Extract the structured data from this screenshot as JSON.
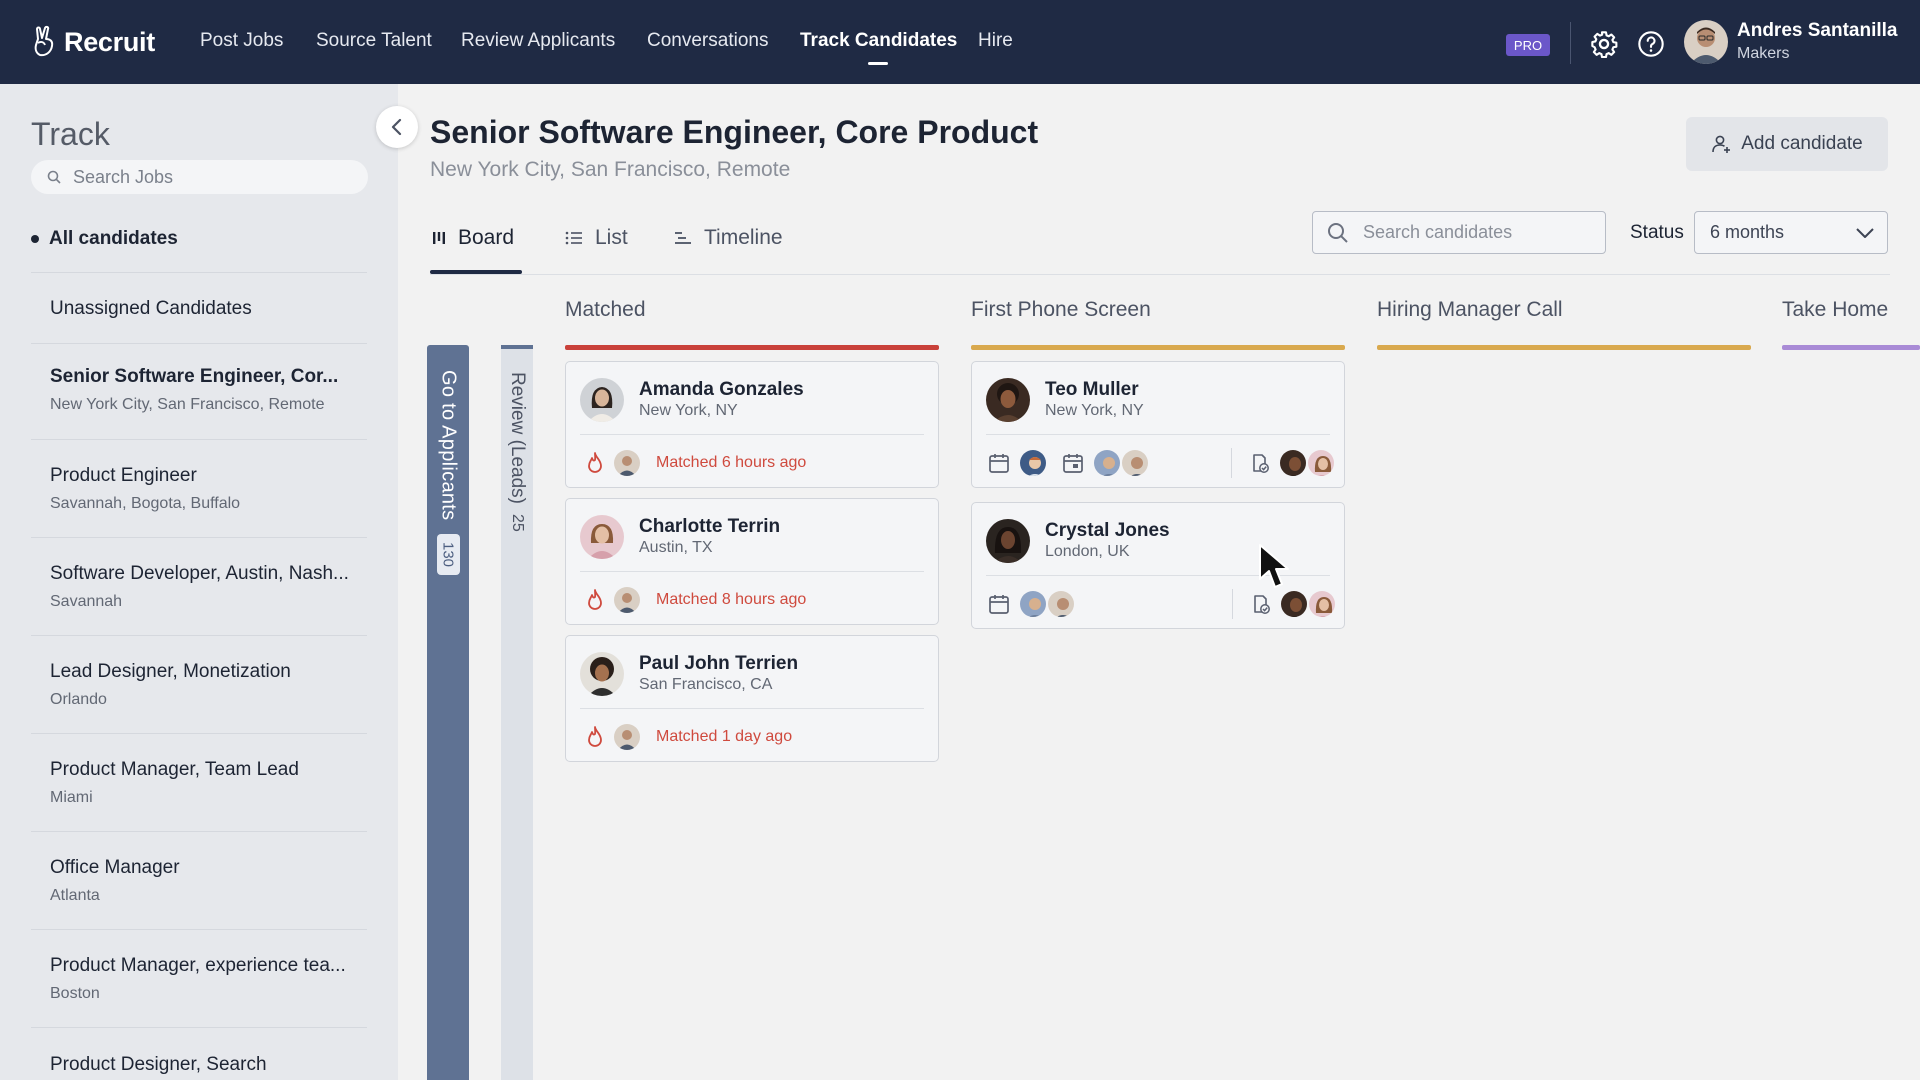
{
  "nav": {
    "brand": "Recruit",
    "links": [
      "Post Jobs",
      "Source Talent",
      "Review Applicants",
      "Conversations",
      "Track Candidates",
      "Hire"
    ],
    "active_link": "Track Candidates",
    "pro_badge": "PRO",
    "user": {
      "name": "Andres Santanilla",
      "org": "Makers"
    }
  },
  "sidebar": {
    "title": "Track",
    "search_placeholder": "Search Jobs",
    "all_candidates": "All candidates",
    "items": [
      {
        "title": "Unassigned Candidates",
        "subtitle": ""
      },
      {
        "title": "Senior Software Engineer, Cor...",
        "subtitle": "New York City, San Francisco, Remote",
        "selected": true
      },
      {
        "title": "Product Engineer",
        "subtitle": "Savannah, Bogota, Buffalo"
      },
      {
        "title": "Software Developer, Austin, Nash...",
        "subtitle": "Savannah"
      },
      {
        "title": "Lead Designer, Monetization",
        "subtitle": "Orlando"
      },
      {
        "title": "Product Manager, Team Lead",
        "subtitle": "Miami"
      },
      {
        "title": "Office Manager",
        "subtitle": "Atlanta"
      },
      {
        "title": "Product Manager, experience tea...",
        "subtitle": "Boston"
      },
      {
        "title": "Product Designer, Search",
        "subtitle": ""
      }
    ]
  },
  "job": {
    "title": "Senior Software Engineer, Core Product",
    "locations": "New York City, San Francisco, Remote",
    "add_candidate": "Add candidate"
  },
  "view_tabs": [
    "Board",
    "List",
    "Timeline"
  ],
  "active_tab": "Board",
  "controls": {
    "search_placeholder": "Search candidates",
    "status_label": "Status",
    "status_value": "6 months"
  },
  "strips": {
    "go_to_applicants": {
      "label": "Go to Applicants",
      "count": "130"
    },
    "review_leads": {
      "label": "Review (Leads)",
      "count": "25"
    }
  },
  "columns": [
    {
      "title": "Matched",
      "color": "#c9413a"
    },
    {
      "title": "First Phone Screen",
      "color": "#d9a94e"
    },
    {
      "title": "Hiring Manager Call",
      "color": "#d9a94e"
    },
    {
      "title": "Take Home",
      "color": "#a98bd6"
    }
  ],
  "matched_cards": [
    {
      "name": "Amanda Gonzales",
      "location": "New York, NY",
      "status": "Matched 6 hours ago"
    },
    {
      "name": "Charlotte Terrin",
      "location": "Austin, TX",
      "status": "Matched 8 hours ago"
    },
    {
      "name": "Paul John Terrien",
      "location": "San Francisco, CA",
      "status": "Matched 1 day ago"
    }
  ],
  "phone_screen_cards": [
    {
      "name": "Teo Muller",
      "location": "New York, NY"
    },
    {
      "name": "Crystal Jones",
      "location": "London, UK"
    }
  ],
  "icons": {
    "hot": "flame-icon",
    "calendar": "calendar-icon",
    "scorecard": "clipboard-check-icon",
    "settings": "gear-icon",
    "help": "help-icon"
  },
  "colors": {
    "nav_bg": "#1f2a44",
    "accent_red": "#c9413a",
    "accent_gold": "#d9a94e",
    "accent_purple": "#a98bd6",
    "strip_blue": "#5f7293",
    "pro_purple": "#6b57c9"
  }
}
